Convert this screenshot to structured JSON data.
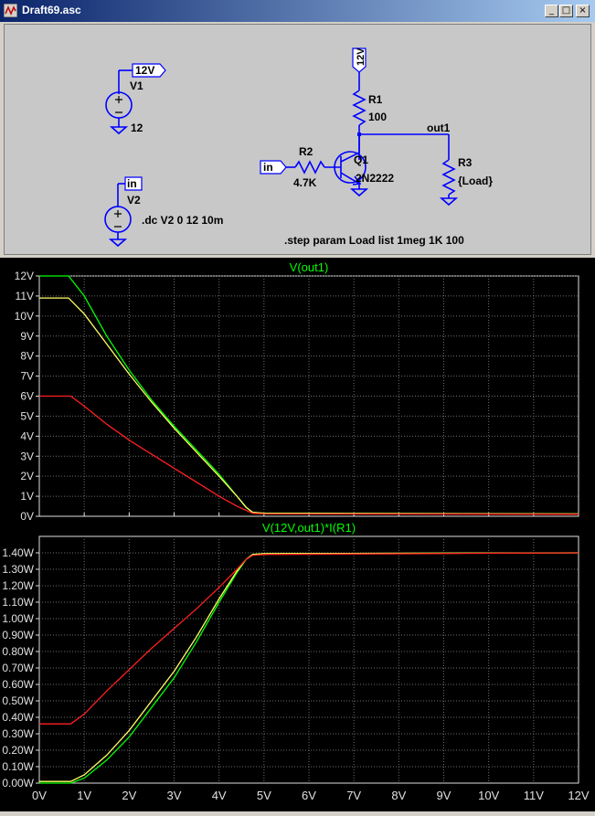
{
  "window": {
    "title": "Draft69.asc",
    "min_label": "_",
    "max_label": "□",
    "close_label": "×"
  },
  "schematic": {
    "v1": {
      "name": "V1",
      "value": "12",
      "net": "12V"
    },
    "v2": {
      "name": "V2",
      "net": "in",
      "directive": ".dc V2 0 12 10m"
    },
    "r1": {
      "name": "R1",
      "value": "100",
      "net": "12V"
    },
    "r2": {
      "name": "R2",
      "value": "4.7K",
      "net": "in"
    },
    "q1": {
      "name": "Q1",
      "value": "2N2222"
    },
    "r3": {
      "name": "R3",
      "value": "{Load}"
    },
    "out_net": "out1",
    "step_directive": ".step param Load list 1meg 1K 100"
  },
  "colors": {
    "green": "#00ff00",
    "yellow": "#ffff66",
    "red": "#ff2020",
    "grid": "#6e6e6e",
    "axis": "#e0e0e0"
  },
  "chart_data": [
    {
      "type": "line",
      "title": "V(out1)",
      "xlabel": "",
      "ylabel": "",
      "xlim": [
        0,
        12
      ],
      "ylim": [
        0,
        12
      ],
      "x_ticks": [
        "0V",
        "1V",
        "2V",
        "3V",
        "4V",
        "5V",
        "6V",
        "7V",
        "8V",
        "9V",
        "10V",
        "11V",
        "12V"
      ],
      "y_ticks": [
        "0V",
        "1V",
        "2V",
        "3V",
        "4V",
        "5V",
        "6V",
        "7V",
        "8V",
        "9V",
        "10V",
        "11V",
        "12V"
      ],
      "grid": true,
      "series": [
        {
          "color": "green",
          "x": [
            0,
            0.65,
            1.0,
            1.5,
            2.0,
            2.5,
            3.0,
            3.5,
            4.0,
            4.4,
            4.6,
            4.75,
            5.0,
            12
          ],
          "y": [
            12,
            12,
            11.0,
            9.0,
            7.3,
            5.8,
            4.5,
            3.3,
            2.1,
            1.0,
            0.45,
            0.2,
            0.15,
            0.12
          ]
        },
        {
          "color": "yellow",
          "x": [
            0,
            0.65,
            1.0,
            1.5,
            2.0,
            2.5,
            3.0,
            3.5,
            4.0,
            4.4,
            4.6,
            4.75,
            5.0,
            12
          ],
          "y": [
            10.9,
            10.9,
            10.1,
            8.6,
            7.1,
            5.7,
            4.4,
            3.2,
            2.0,
            1.0,
            0.45,
            0.2,
            0.15,
            0.12
          ]
        },
        {
          "color": "red",
          "x": [
            0,
            0.7,
            1.0,
            1.5,
            2.0,
            2.5,
            3.0,
            3.5,
            4.0,
            4.4,
            4.6,
            4.75,
            5.0,
            12
          ],
          "y": [
            6.0,
            6.0,
            5.5,
            4.6,
            3.8,
            3.1,
            2.4,
            1.7,
            1.0,
            0.5,
            0.3,
            0.15,
            0.12,
            0.1
          ]
        }
      ]
    },
    {
      "type": "line",
      "title": "V(12V,out1)*I(R1)",
      "xlabel": "",
      "ylabel": "",
      "xlim": [
        0,
        12
      ],
      "ylim": [
        0,
        1.5
      ],
      "x_ticks": [
        "0V",
        "1V",
        "2V",
        "3V",
        "4V",
        "5V",
        "6V",
        "7V",
        "8V",
        "9V",
        "10V",
        "11V",
        "12V"
      ],
      "y_ticks": [
        "0.00W",
        "0.10W",
        "0.20W",
        "0.30W",
        "0.40W",
        "0.50W",
        "0.60W",
        "0.70W",
        "0.80W",
        "0.90W",
        "1.00W",
        "1.10W",
        "1.20W",
        "1.30W",
        "1.40W"
      ],
      "grid": true,
      "series": [
        {
          "color": "green",
          "x": [
            0,
            0.7,
            1.0,
            1.5,
            2.0,
            2.5,
            3.0,
            3.5,
            4.0,
            4.4,
            4.6,
            4.75,
            5.0,
            12
          ],
          "y": [
            0.0,
            0.0,
            0.03,
            0.14,
            0.28,
            0.46,
            0.64,
            0.86,
            1.1,
            1.28,
            1.36,
            1.39,
            1.395,
            1.4
          ]
        },
        {
          "color": "yellow",
          "x": [
            0,
            0.7,
            1.0,
            1.5,
            2.0,
            2.5,
            3.0,
            3.5,
            4.0,
            4.4,
            4.6,
            4.75,
            5.0,
            12
          ],
          "y": [
            0.01,
            0.01,
            0.05,
            0.17,
            0.32,
            0.5,
            0.68,
            0.89,
            1.12,
            1.29,
            1.36,
            1.39,
            1.395,
            1.4
          ]
        },
        {
          "color": "red",
          "x": [
            0,
            0.7,
            1.0,
            1.5,
            2.0,
            2.5,
            3.0,
            3.5,
            4.0,
            4.4,
            4.6,
            4.75,
            5.0,
            12
          ],
          "y": [
            0.36,
            0.36,
            0.42,
            0.56,
            0.69,
            0.82,
            0.94,
            1.06,
            1.19,
            1.3,
            1.36,
            1.385,
            1.39,
            1.4
          ]
        }
      ]
    }
  ]
}
